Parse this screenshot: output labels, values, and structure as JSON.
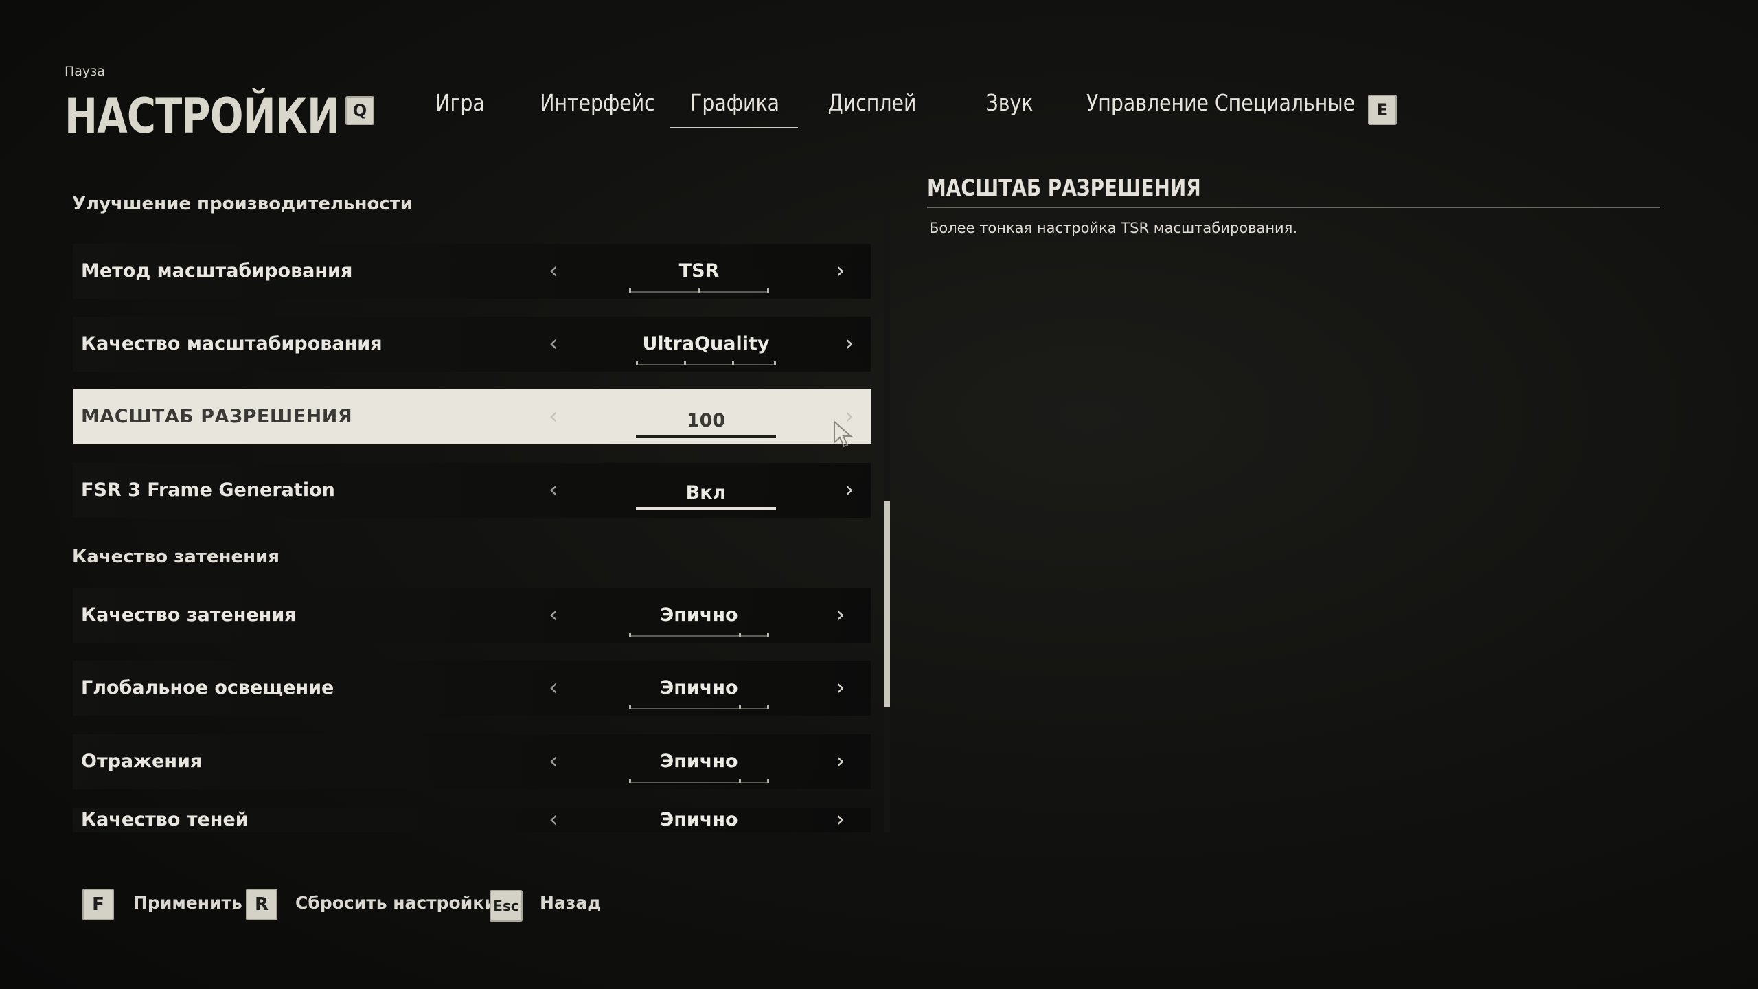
{
  "header": {
    "pause_label": "Пауза",
    "title": "НАСТРОЙКИ"
  },
  "tabs": {
    "prev_key": "Q",
    "next_key": "E",
    "items": [
      {
        "label": "Игра"
      },
      {
        "label": "Интерфейс"
      },
      {
        "label": "Графика"
      },
      {
        "label": "Дисплей"
      },
      {
        "label": "Звук"
      },
      {
        "label": "Управление"
      },
      {
        "label": "Специальные"
      }
    ],
    "active": "Графика"
  },
  "settings": {
    "section_performance": "Улучшение производительности",
    "section_shading": "Качество затенения",
    "rows": [
      {
        "label": "Метод масштабирования",
        "value": "TSR"
      },
      {
        "label": "Качество масштабирования",
        "value": "UltraQuality"
      },
      {
        "label": "МАСШТАБ РАЗРЕШЕНИЯ",
        "value": "100",
        "selected": true
      },
      {
        "label": "FSR 3 Frame Generation",
        "value": "Вкл"
      },
      {
        "label": "Качество затенения",
        "value": "Эпично"
      },
      {
        "label": "Глобальное освещение",
        "value": "Эпично"
      },
      {
        "label": "Отражения",
        "value": "Эпично"
      },
      {
        "label": "Качество теней",
        "value": "Эпично"
      }
    ],
    "arrow_left": "‹",
    "arrow_right": "›"
  },
  "description": {
    "title": "МАСШТАБ РАЗРЕШЕНИЯ",
    "text": "Более тонкая настройка TSR масштабирования."
  },
  "footer": {
    "apply_key": "F",
    "apply_label": "Применить",
    "reset_key": "R",
    "reset_label": "Сбросить настройки",
    "back_key": "Esc",
    "back_label": "Назад"
  },
  "colors": {
    "accent_light": "#e8e5dc",
    "background": "#121210"
  }
}
